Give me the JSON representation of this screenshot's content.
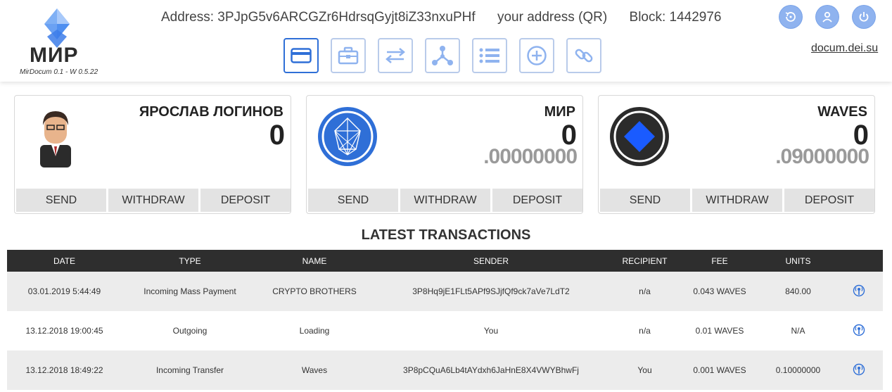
{
  "app": {
    "logo_title": "МИР",
    "logo_subtitle": "MirDocum 0.1 - W 0.5.22"
  },
  "header": {
    "address": "Address: 3PJpG5v6ARCGZr6HdrsqGyjt8iZ33nxuPHf",
    "qr_link": "your address (QR)",
    "block": "Block: 1442976",
    "docum_link": "docum.dei.su"
  },
  "nav": {
    "items": [
      {
        "icon": "wallet-card-icon",
        "active": true
      },
      {
        "icon": "briefcase-icon",
        "active": false
      },
      {
        "icon": "transfer-arrows-icon",
        "active": false
      },
      {
        "icon": "network-nodes-icon",
        "active": false
      },
      {
        "icon": "list-icon",
        "active": false
      },
      {
        "icon": "add-circle-icon",
        "active": false
      },
      {
        "icon": "link-icon",
        "active": false
      }
    ]
  },
  "top_icons": [
    "history-icon",
    "user-icon",
    "power-icon"
  ],
  "colors": {
    "accent": "#2f6fd7",
    "nav_border": "#b9cbea",
    "circle_button": "#8fb3ef",
    "table_header": "#2e2e2e",
    "mir_coin": "#2f6fd7",
    "waves_diamond": "#1a5bff"
  },
  "cards": [
    {
      "name": "ЯРОСЛАВ ЛОГИНОВ",
      "balance_int": "0",
      "balance_frac": "",
      "image": "avatar-person",
      "actions": [
        "SEND",
        "WITHDRAW",
        "DEPOSIT"
      ]
    },
    {
      "name": "МИР",
      "balance_int": "0",
      "balance_frac": ".00000000",
      "image": "mir-token-icon",
      "actions": [
        "SEND",
        "WITHDRAW",
        "DEPOSIT"
      ]
    },
    {
      "name": "WAVES",
      "balance_int": "0",
      "balance_frac": ".09000000",
      "image": "waves-token-icon",
      "actions": [
        "SEND",
        "WITHDRAW",
        "DEPOSIT"
      ]
    }
  ],
  "transactions": {
    "title": "LATEST TRANSACTIONS",
    "columns": [
      "DATE",
      "TYPE",
      "NAME",
      "SENDER",
      "RECIPIENT",
      "FEE",
      "UNITS",
      ""
    ],
    "rows": [
      [
        "03.01.2019 5:44:49",
        "Incoming Mass Payment",
        "CRYPTO BROTHERS",
        "3P8Hq9jE1FLt5APf9SJjfQf9ck7aVe7LdT2",
        "n/a",
        "0.043 WAVES",
        "840.00"
      ],
      [
        "13.12.2018 19:00:45",
        "Outgoing",
        "Loading",
        "You",
        "n/a",
        "0.01 WAVES",
        "N/A"
      ],
      [
        "13.12.2018 18:49:22",
        "Incoming Transfer",
        "Waves",
        "3P8pCQuA6Lb4tAYdxh6JaHnE8X4VWYBhwFj",
        "You",
        "0.001 WAVES",
        "0.10000000"
      ]
    ]
  }
}
